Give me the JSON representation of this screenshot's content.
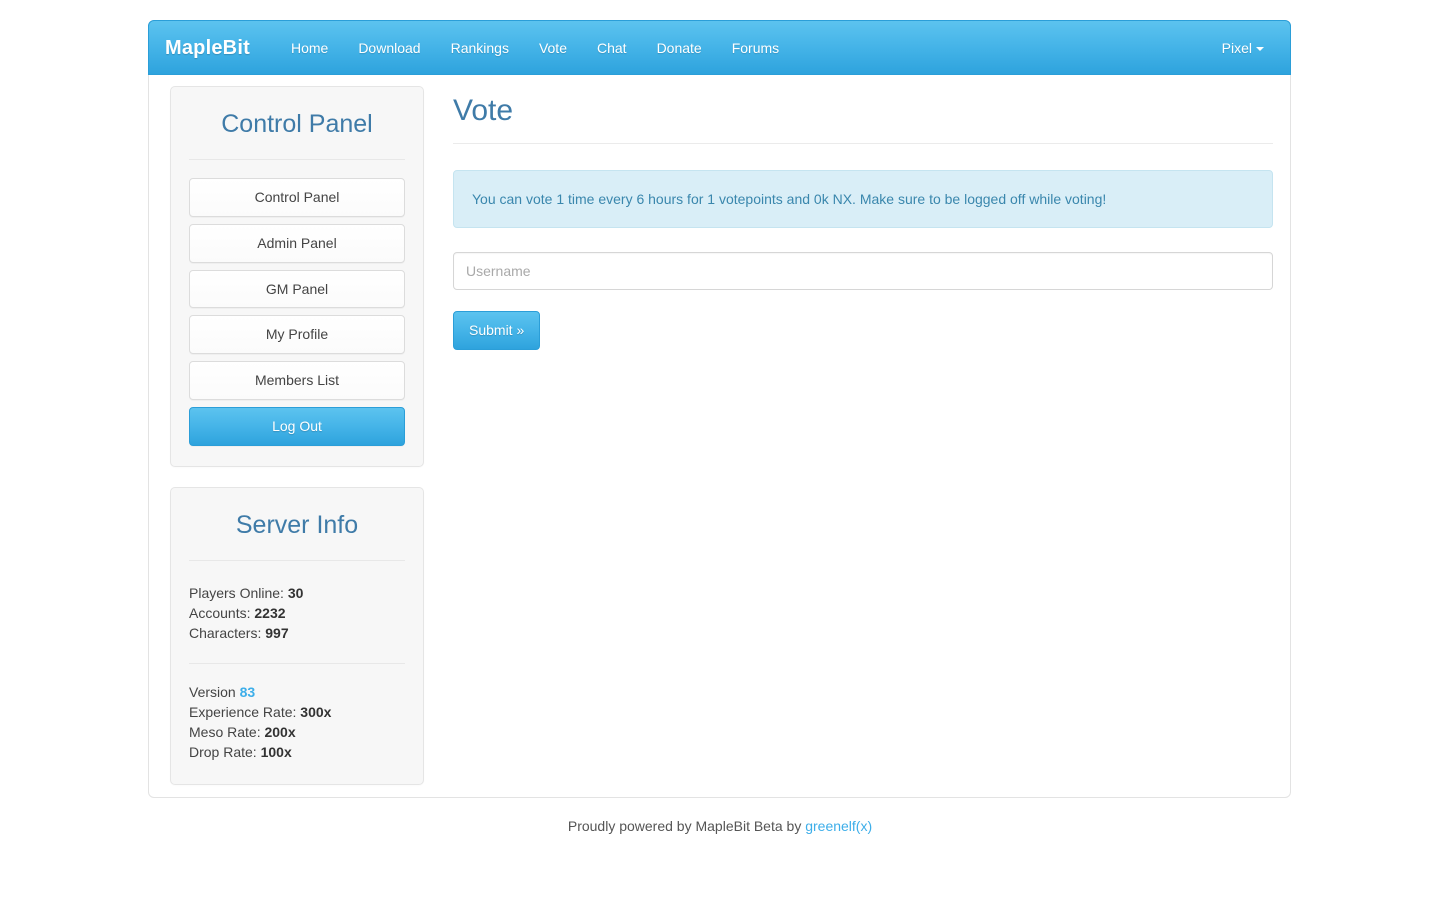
{
  "navbar": {
    "brand": "MapleBit",
    "links": [
      {
        "label": "Home"
      },
      {
        "label": "Download"
      },
      {
        "label": "Rankings"
      },
      {
        "label": "Vote"
      },
      {
        "label": "Chat"
      },
      {
        "label": "Donate"
      },
      {
        "label": "Forums"
      }
    ],
    "user": "Pixel",
    "caret_icon": "chevron-down-icon",
    "accent_color": "#3aa9e0"
  },
  "sidebar": {
    "control_panel": {
      "title": "Control Panel",
      "buttons": [
        {
          "label": "Control Panel",
          "style": "default"
        },
        {
          "label": "Admin Panel",
          "style": "default"
        },
        {
          "label": "GM Panel",
          "style": "default"
        },
        {
          "label": "My Profile",
          "style": "default"
        },
        {
          "label": "Members List",
          "style": "default"
        },
        {
          "label": "Log Out",
          "style": "primary"
        }
      ]
    },
    "server_info": {
      "title": "Server Info",
      "stats": [
        {
          "label": "Players Online:",
          "value": "30"
        },
        {
          "label": "Accounts:",
          "value": "2232"
        },
        {
          "label": "Characters:",
          "value": "997"
        }
      ],
      "version_label": "Version",
      "version_value": "83",
      "rates": [
        {
          "label": "Experience Rate:",
          "value": "300x"
        },
        {
          "label": "Meso Rate:",
          "value": "200x"
        },
        {
          "label": "Drop Rate:",
          "value": "100x"
        }
      ]
    }
  },
  "main": {
    "title": "Vote",
    "alert_text": "You can vote 1 time every 6 hours for 1 votepoints and 0k NX. Make sure to be logged off while voting!",
    "username_placeholder": "Username",
    "username_value": "",
    "submit_label": "Submit »"
  },
  "footer": {
    "text": "Proudly powered by MapleBit Beta by ",
    "link_label": "greenelf(x)"
  }
}
